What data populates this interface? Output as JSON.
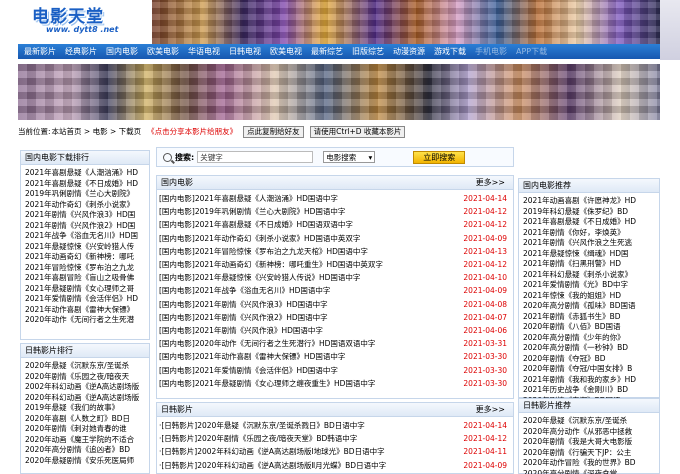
{
  "logo": {
    "title": "电影天堂",
    "domain": "www. dytt8 .net"
  },
  "nav": [
    "最新影片",
    "经典影片",
    "国内电影",
    "欧美电影",
    "华语电视",
    "日韩电视",
    "欧美电视",
    "最新综艺",
    "旧版综艺",
    "动漫资源",
    "游戏下载",
    "手机电影",
    "APP下载"
  ],
  "location": {
    "label": "当前位置:",
    "path": "本站首页 > 电影 > 下载页",
    "promo": "《点击分享本影片给朋友》",
    "copy_button": "点此复制给好友",
    "bookmark_button": "请使用Ctrl+D 收藏本影片"
  },
  "search": {
    "label": "搜索:",
    "placeholder": "关键字",
    "select": "电影搜索",
    "button": "立即搜索"
  },
  "left_panels": [
    {
      "title": "国内电影下载排行",
      "items": [
        "2021年喜剧悬疑《人潮汹涌》HD",
        "2021年喜剧悬疑《不日成婚》HD",
        "2019年巩俐剧情《兰心大剧院》",
        "2021年动作奇幻《刺杀小说家》",
        "2021年剧情《兴风作浪3》HD国",
        "2021年剧情《兴风作浪2》HD国",
        "2021年战争《浴血无名川》HD国",
        "2021年悬疑惊悚《兴安岭猎人传",
        "2021年动画奇幻《新神榜：哪吒",
        "2021年冒险惊悚《罗布泊之九龙",
        "2021年喜剧冒险《盲山之吸骨佛",
        "2021年悬疑剧情《女心理师之哥",
        "2021年爱情剧情《会活伴侣》HD",
        "2021年动作喜剧《雷神大保镖》",
        "2020年动作《无间行者之生死潜"
      ]
    },
    {
      "title": "日韩影片排行",
      "items": [
        "2020年悬疑《沉默东京/圣诞杀",
        "2020年剧情《乐园之夜/暗夜天",
        "2002年科幻动画《逆A高达剧场版",
        "2020年科幻动画《逆A高达剧场版",
        "2019年悬疑《我们的故事》",
        "2020年喜剧《人数之町》BD日",
        "2020年剧情《刺对她青春的谁",
        "2020年动画《魔王学院的不适合",
        "2020年高分剧情《追凶者》BD",
        "2020年悬疑剧情《安乐死医局师"
      ]
    }
  ],
  "right_panels": [
    {
      "title": "国内电影推荐",
      "items": [
        "2021年动画喜剧《许愿神龙》HD",
        "2019年科幻悬疑《侏罗纪》BD",
        "2021年喜剧悬疑《不日成婚》HD",
        "2021年剧情《你好，李焕英》",
        "2021年剧情《兴风作浪之生死逃",
        "2021年悬疑惊悚《缉魂》HD国",
        "2021年剧情《扫黑刑警》HD",
        "2021年科幻悬疑《刺杀小说家》",
        "2021年爱情剧情《光》BD中字",
        "2021年惊悚《我的姐姐》HD",
        "2020年高分剧情《孤味》BD国语",
        "2021年剧情《赤狐书生》BD",
        "2020年剧情《八佰》BD国语",
        "2020年高分剧情《少年的你》",
        "2020年高分剧情《一秒钟》BD",
        "2020年剧情《夺冠》BD",
        "2020年剧情《夺冠/中国女排》B",
        "2021年剧情《我和我的家乡》HD",
        "2021年历史战争《金刚川》BD",
        "2020年剧情《春潮》BD国语"
      ]
    },
    {
      "title": "日韩影片推荐",
      "items": [
        "2020年悬疑《沉默东京/圣诞杀",
        "2020年高分动作《从邪恶中拯救",
        "2020年剧情《我是大哥大电影版",
        "2020年剧情《行骗天下JP：公主",
        "2020年动作冒险《我的世界》BD",
        "2020年高分剧情《深夜食堂",
        "2020年剧情《爱·孤影》BD"
      ]
    }
  ],
  "list_panels": [
    {
      "title": "国内电影",
      "more": "更多>>",
      "rows": [
        {
          "title": "[国内电影]2021年喜剧悬疑《人潮汹涌》HD国语中字",
          "date": "2021-04-14"
        },
        {
          "title": "[国内电影]2019年巩俐剧情《兰心大剧院》HD国语中字",
          "date": "2021-04-12"
        },
        {
          "title": "[国内电影]2021年喜剧悬疑《不日成婚》HD国语双语中字",
          "date": "2021-04-12"
        },
        {
          "title": "[国内电影]2021年动作奇幻《刺杀小说家》HD国语中英双字",
          "date": "2021-04-09"
        },
        {
          "title": "[国内电影]2021年冒险惊悚《罗布泊之九龙天棺》HD国语中字",
          "date": "2021-04-13"
        },
        {
          "title": "[国内电影]2021年动画奇幻《新神榜：哪吒重生》HD国语中英双字",
          "date": "2021-04-12"
        },
        {
          "title": "[国内电影]2021年悬疑惊悚《兴安岭猎人传说》HD国语中字",
          "date": "2021-04-10"
        },
        {
          "title": "[国内电影]2021年战争《浴血无名川》HD国语中字",
          "date": "2021-04-09"
        },
        {
          "title": "[国内电影]2021年剧情《兴风作浪3》HD国语中字",
          "date": "2021-04-08"
        },
        {
          "title": "[国内电影]2021年剧情《兴风作浪2》HD国语中字",
          "date": "2021-04-07"
        },
        {
          "title": "[国内电影]2021年剧情《兴风作浪》HD国语中字",
          "date": "2021-04-06"
        },
        {
          "title": "[国内电影]2020年动作《无间行者之生死潜行》HD国语双语中字",
          "date": "2021-03-31"
        },
        {
          "title": "[国内电影]2021年动作喜剧《雷神大保镖》HD国语中字",
          "date": "2021-03-30"
        },
        {
          "title": "[国内电影]2021年爱情剧情《会活伴侣》HD国语中字",
          "date": "2021-03-30"
        },
        {
          "title": "[国内电影]2021年悬疑剧情《女心理师之缠夜重生》HD国语中字",
          "date": "2021-03-30"
        }
      ]
    },
    {
      "title": "日韩影片",
      "more": "更多>>",
      "rows": [
        {
          "title": "·[日韩影片]2020年悬疑《沉默东京/圣诞杀戮日》BD日语中字",
          "date": "2021-04-14"
        },
        {
          "title": "·[日韩影片]2020年剧情《乐园之夜/暗夜天堂》BD韩语中字",
          "date": "2021-04-12"
        },
        {
          "title": "·[日韩影片]2002年科幻动画《逆A高达剧场版Ⅰ地球光》BD日语中字",
          "date": "2021-04-11"
        },
        {
          "title": "·[日韩影片]2020年科幻动画《逆A高达剧场版Ⅱ月光蝶》BD日语中字",
          "date": "2021-04-09"
        }
      ]
    }
  ]
}
